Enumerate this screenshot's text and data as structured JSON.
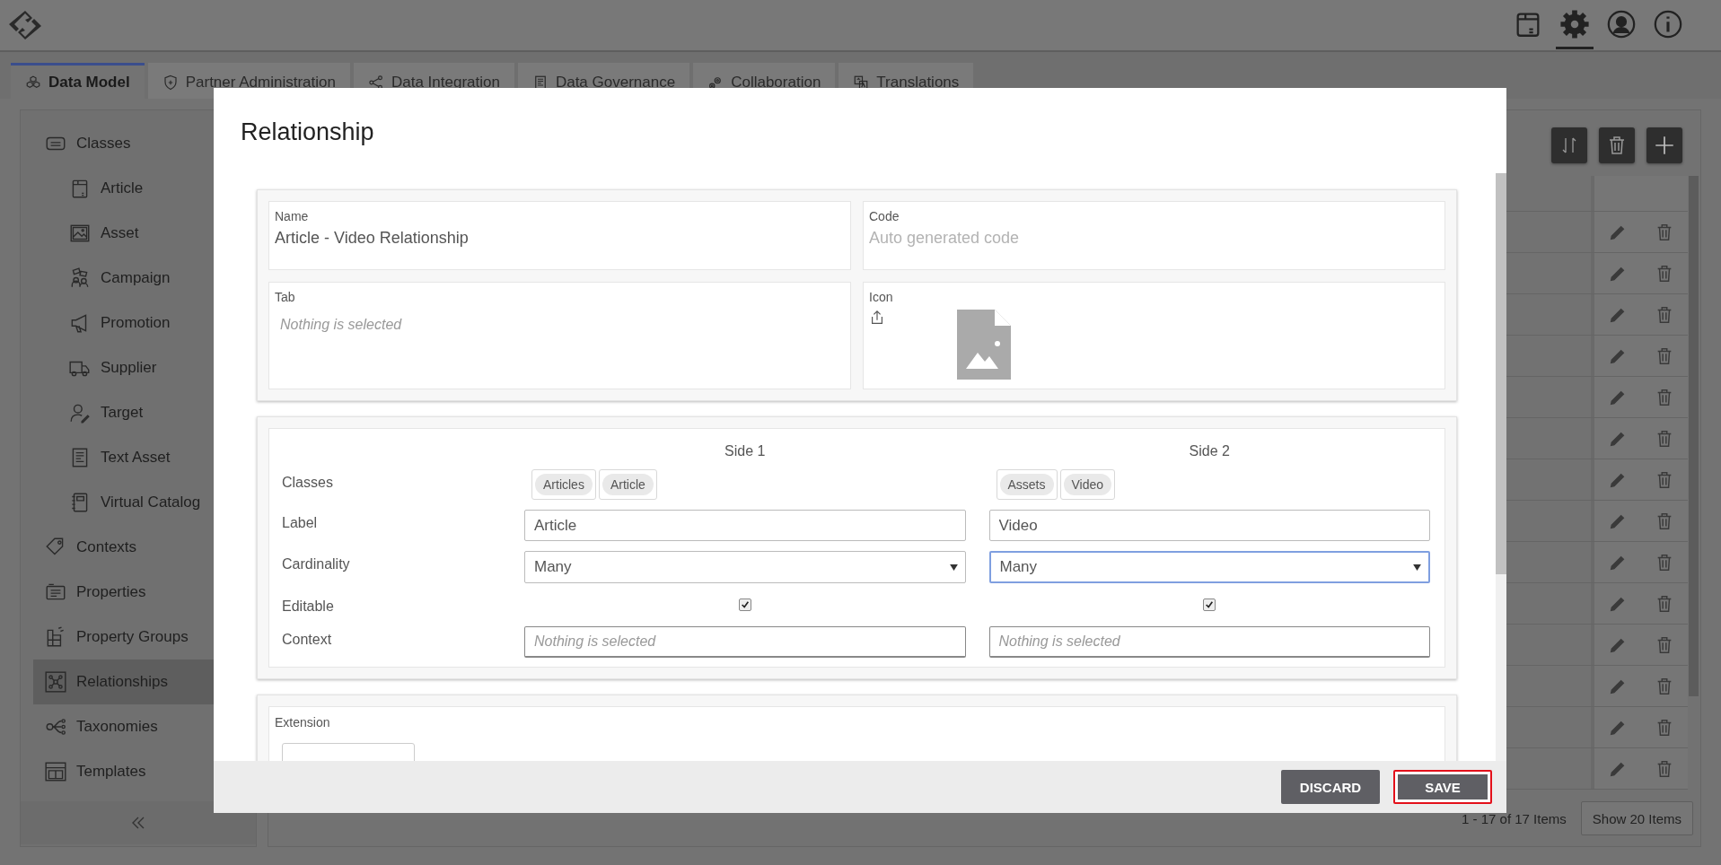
{
  "header": {
    "icons": [
      {
        "kind": "box",
        "selected": false
      },
      {
        "kind": "settings",
        "selected": true
      },
      {
        "kind": "user",
        "selected": false
      },
      {
        "kind": "info",
        "selected": false
      }
    ]
  },
  "tabs": [
    {
      "label": "Data Model",
      "kind": "cubes",
      "selected": true
    },
    {
      "label": "Partner Administration",
      "kind": "shield",
      "selected": false
    },
    {
      "label": "Data Integration",
      "kind": "share",
      "selected": false
    },
    {
      "label": "Data Governance",
      "kind": "document",
      "selected": false
    },
    {
      "label": "Collaboration",
      "kind": "gears",
      "selected": false
    },
    {
      "label": "Translations",
      "kind": "translate",
      "selected": false
    }
  ],
  "sidebar": {
    "items": [
      {
        "label": "Classes",
        "kind": "list",
        "selected": false,
        "children": [
          {
            "label": "Article",
            "kind": "box",
            "selected": false
          },
          {
            "label": "Asset",
            "kind": "image",
            "selected": false
          },
          {
            "label": "Campaign",
            "kind": "people",
            "selected": false
          },
          {
            "label": "Promotion",
            "kind": "megaphone",
            "selected": false
          },
          {
            "label": "Supplier",
            "kind": "truck",
            "selected": false
          },
          {
            "label": "Target",
            "kind": "person",
            "selected": false
          },
          {
            "label": "Text Asset",
            "kind": "document",
            "selected": false
          },
          {
            "label": "Virtual Catalog",
            "kind": "notebook",
            "selected": false
          }
        ]
      },
      {
        "label": "Contexts",
        "kind": "tag",
        "selected": false
      },
      {
        "label": "Properties",
        "kind": "card",
        "selected": false
      },
      {
        "label": "Property Groups",
        "kind": "stack",
        "selected": false
      },
      {
        "label": "Relationships",
        "kind": "network",
        "selected": true
      },
      {
        "label": "Taxonomies",
        "kind": "tree",
        "selected": false
      },
      {
        "label": "Templates",
        "kind": "layout",
        "selected": false
      }
    ]
  },
  "pagination": {
    "summary": "1 - 17 of 17 Items",
    "page_size": "Show 20 Items"
  },
  "dialog": {
    "title": "Relationship",
    "name": {
      "label": "Name",
      "value": "Article - Video Relationship"
    },
    "code": {
      "label": "Code",
      "placeholder": "Auto generated code"
    },
    "tab": {
      "label": "Tab",
      "placeholder": "Nothing is selected"
    },
    "icon": {
      "label": "Icon"
    },
    "row_labels": [
      "Classes",
      "Label",
      "Cardinality",
      "Editable",
      "Context"
    ],
    "sides": [
      {
        "heading": "Side 1",
        "classes": [
          "Articles",
          "Article"
        ],
        "label": "Article",
        "cardinality": "Many",
        "cardinality_focused": false,
        "editable": true,
        "context_placeholder": "Nothing is selected"
      },
      {
        "heading": "Side 2",
        "classes": [
          "Assets",
          "Video"
        ],
        "label": "Video",
        "cardinality": "Many",
        "cardinality_focused": true,
        "editable": true,
        "context_placeholder": "Nothing is selected"
      }
    ],
    "extension": {
      "label": "Extension"
    },
    "buttons": [
      {
        "label": "DISCARD",
        "highlighted": false
      },
      {
        "label": "SAVE",
        "highlighted": true
      }
    ]
  }
}
